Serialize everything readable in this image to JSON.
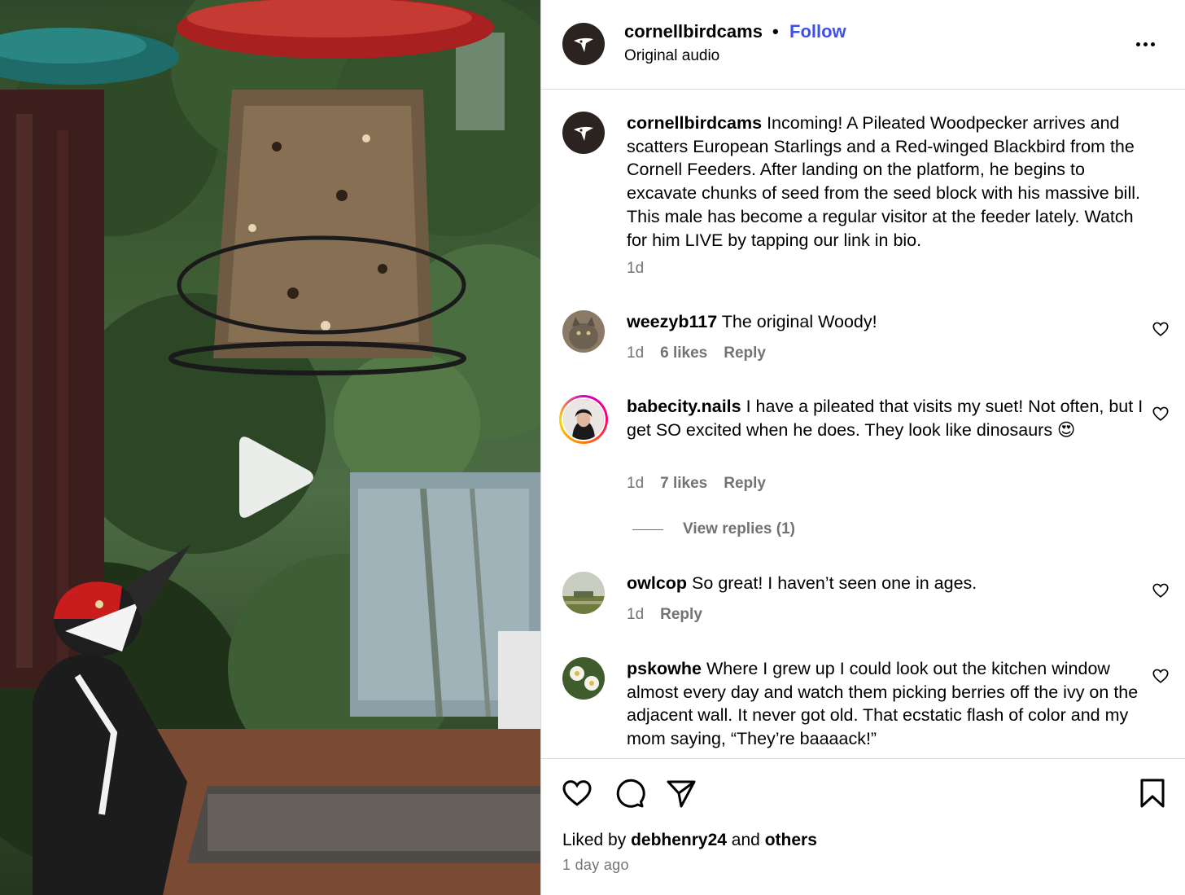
{
  "post": {
    "username": "cornellbirdcams",
    "separator": "•",
    "follow_label": "Follow",
    "audio_label": "Original audio"
  },
  "caption": {
    "username": "cornellbirdcams",
    "text": "Incoming! A Pileated Woodpecker arrives and scatters European Starlings and a Red-winged Blackbird from the Cornell Feeders. After landing on the platform, he begins to excavate chunks of seed from the seed block with his massive bill. This male has become a regular visitor at the feeder lately. Watch for him LIVE by tapping our link in bio.",
    "time": "1d"
  },
  "comments": [
    {
      "username": "weezyb117",
      "text": "The original Woody!",
      "time": "1d",
      "likes": "6 likes",
      "reply": "Reply"
    },
    {
      "username": "babecity.nails",
      "text": "I have a pileated that visits my suet! Not often, but I get SO excited when he does. They look like dinosaurs 😍",
      "time": "1d",
      "likes": "7 likes",
      "reply": "Reply"
    },
    {
      "username": "owlcop",
      "text": "So great! I haven’t seen one in ages.",
      "time": "1d",
      "reply": "Reply"
    },
    {
      "username": "pskowhe",
      "text": "Where I grew up I could look out the kitchen window almost every day and watch them picking berries off the ivy on the adjacent wall. It never got old. That ecstatic flash of color and my mom saying, “They’re baaaack!”"
    }
  ],
  "view_replies": "View replies (1)",
  "footer": {
    "liked_prefix": "Liked by",
    "liked_user": "debhenry24",
    "liked_and": "and",
    "liked_others": "others",
    "time_ago": "1 day ago"
  },
  "icons": {
    "more": "more-options-icon",
    "heart": "heart-icon",
    "comment": "comment-icon",
    "share": "share-icon",
    "save": "bookmark-icon",
    "play": "play-icon"
  },
  "colors": {
    "follow": "#3f51e8",
    "muted": "#737373",
    "divider": "#dbdbdb",
    "brand_avatar": "#2b2320"
  }
}
